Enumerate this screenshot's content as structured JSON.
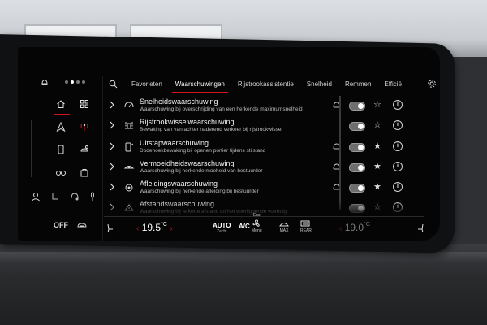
{
  "tabs": [
    "Favorieten",
    "Waarschuwingen",
    "Rijstrookassistentie",
    "Snelheid",
    "Remmen",
    "Efficië"
  ],
  "active_tab_index": 1,
  "rows": [
    {
      "title": "Snelheidswaarschuwing",
      "desc": "Waarschuwing bij overschrijding van een herkende maximumsnelheid",
      "feature_icon": "speed-warning-icon",
      "has_mode_icon": true,
      "toggle_on": true,
      "favorite": false
    },
    {
      "title": "Rijstrookwisselwaarschuwing",
      "desc": "Bewaking van van achter naderend verkeer bij rijstrookwissel",
      "feature_icon": "lane-change-warning-icon",
      "has_mode_icon": false,
      "toggle_on": true,
      "favorite": false
    },
    {
      "title": "Uitstapwaarschuwing",
      "desc": "Dodehoekbewaking bij openen portier tijdens stilstand",
      "feature_icon": "exit-warning-icon",
      "has_mode_icon": true,
      "toggle_on": true,
      "favorite": true
    },
    {
      "title": "Vermoeidheidswaarschuwing",
      "desc": "Waarschuwing bij herkende moeheid van bestuurder",
      "feature_icon": "fatigue-warning-icon",
      "has_mode_icon": true,
      "toggle_on": true,
      "favorite": true
    },
    {
      "title": "Afleidingswaarschuwing",
      "desc": "Waarschuwing bij herkende afleiding bij bestuurder",
      "feature_icon": "distraction-warning-icon",
      "has_mode_icon": true,
      "toggle_on": true,
      "favorite": true
    },
    {
      "title": "Afstandswaarschuwing",
      "desc": "Waarschuwing bij te korte afstand tot het voorliggende voertuig",
      "feature_icon": "distance-warning-icon",
      "has_mode_icon": false,
      "toggle_on": true,
      "favorite": false
    }
  ],
  "rail": {
    "off_label": "OFF"
  },
  "climate": {
    "temp_left": "19.5",
    "temp_right": "19.0",
    "unit": "°C",
    "auto_label": "AUTO",
    "auto_sub": "Zacht",
    "ac_label": "A/C",
    "eco_label": "Eco",
    "menu_label": "Menu",
    "max_label": "MAX",
    "rear_label": "REAR"
  },
  "colors": {
    "accent": "#d0131c",
    "background": "#050505",
    "text": "#f4f4f4"
  }
}
